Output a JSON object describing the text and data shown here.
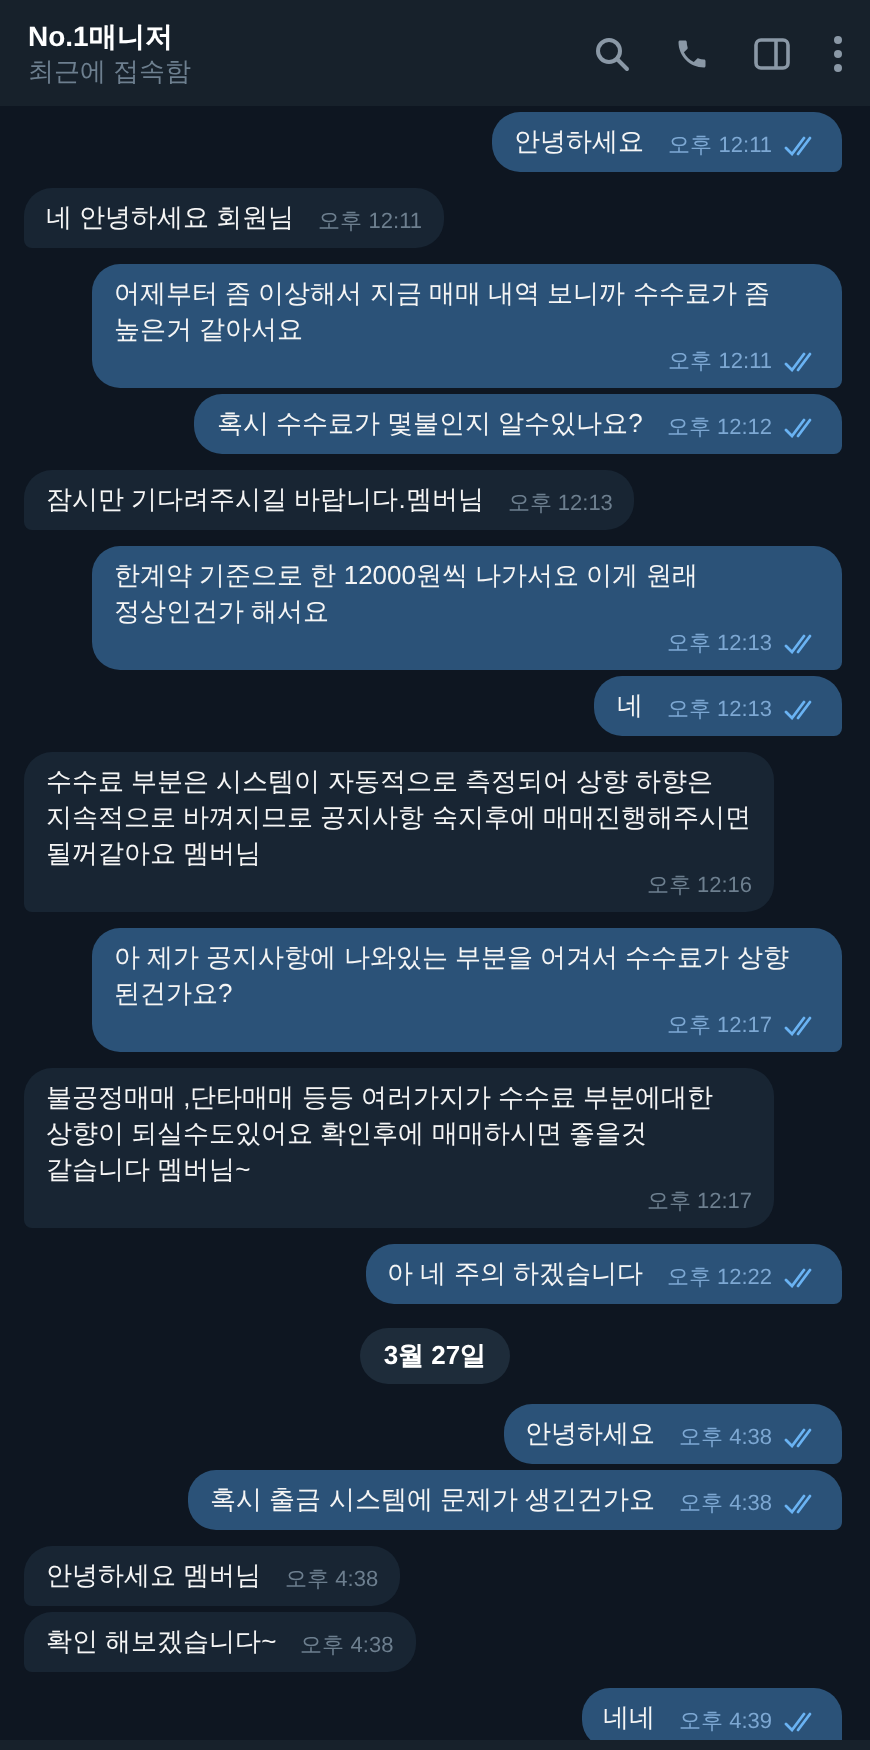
{
  "header": {
    "title": "No.1매니저",
    "status": "최근에 접속함"
  },
  "messages": [
    {
      "kind": "out",
      "text": "안녕하세요",
      "time": "오후 12:11",
      "read": true
    },
    {
      "kind": "in",
      "text": "네 안녕하세요 회원님",
      "time": "오후 12:11"
    },
    {
      "kind": "out",
      "text": "어제부터 좀 이상해서 지금 매매 내역 보니까 수수료가 좀 높은거 같아서요",
      "time": "오후 12:11",
      "read": true
    },
    {
      "kind": "out",
      "text": "혹시 수수료가 몇불인지 알수있나요?",
      "time": "오후 12:12",
      "read": true
    },
    {
      "kind": "in",
      "text": "잠시만 기다려주시길 바랍니다.멤버님",
      "time": "오후 12:13"
    },
    {
      "kind": "out",
      "text": "한계약 기준으로 한 12000원씩 나가서요 이게 원래 정상인건가 해서요",
      "time": "오후 12:13",
      "read": true
    },
    {
      "kind": "out",
      "text": "네",
      "time": "오후 12:13",
      "read": true
    },
    {
      "kind": "in",
      "text": "수수료 부분은 시스템이 자동적으로 측정되어 상향 하향은 지속적으로 바껴지므로 공지사항 숙지후에 매매진행해주시면 될꺼같아요 멤버님",
      "time": "오후 12:16"
    },
    {
      "kind": "out",
      "text": "아 제가 공지사항에 나와있는 부분을 어겨서 수수료가 상향 된건가요?",
      "time": "오후 12:17",
      "read": true
    },
    {
      "kind": "in",
      "text": "불공정매매 ,단타매매 등등 여러가지가 수수료 부분에대한 상향이 되실수도있어요 확인후에 매매하시면 좋을것 같습니다 멤버님~",
      "time": "오후 12:17"
    },
    {
      "kind": "out",
      "text": "아 네 주의 하겠습니다",
      "time": "오후 12:22",
      "read": true
    },
    {
      "kind": "date",
      "text": "3월 27일"
    },
    {
      "kind": "out",
      "text": "안녕하세요",
      "time": "오후 4:38",
      "read": true
    },
    {
      "kind": "out",
      "text": "혹시 출금 시스템에 문제가 생긴건가요",
      "time": "오후 4:38",
      "read": true
    },
    {
      "kind": "in",
      "text": "안녕하세요 멤버님",
      "time": "오후 4:38"
    },
    {
      "kind": "in",
      "text": "확인 해보겠습니다~",
      "time": "오후 4:38"
    },
    {
      "kind": "out",
      "text": "네네",
      "time": "오후 4:39",
      "read": true
    }
  ]
}
